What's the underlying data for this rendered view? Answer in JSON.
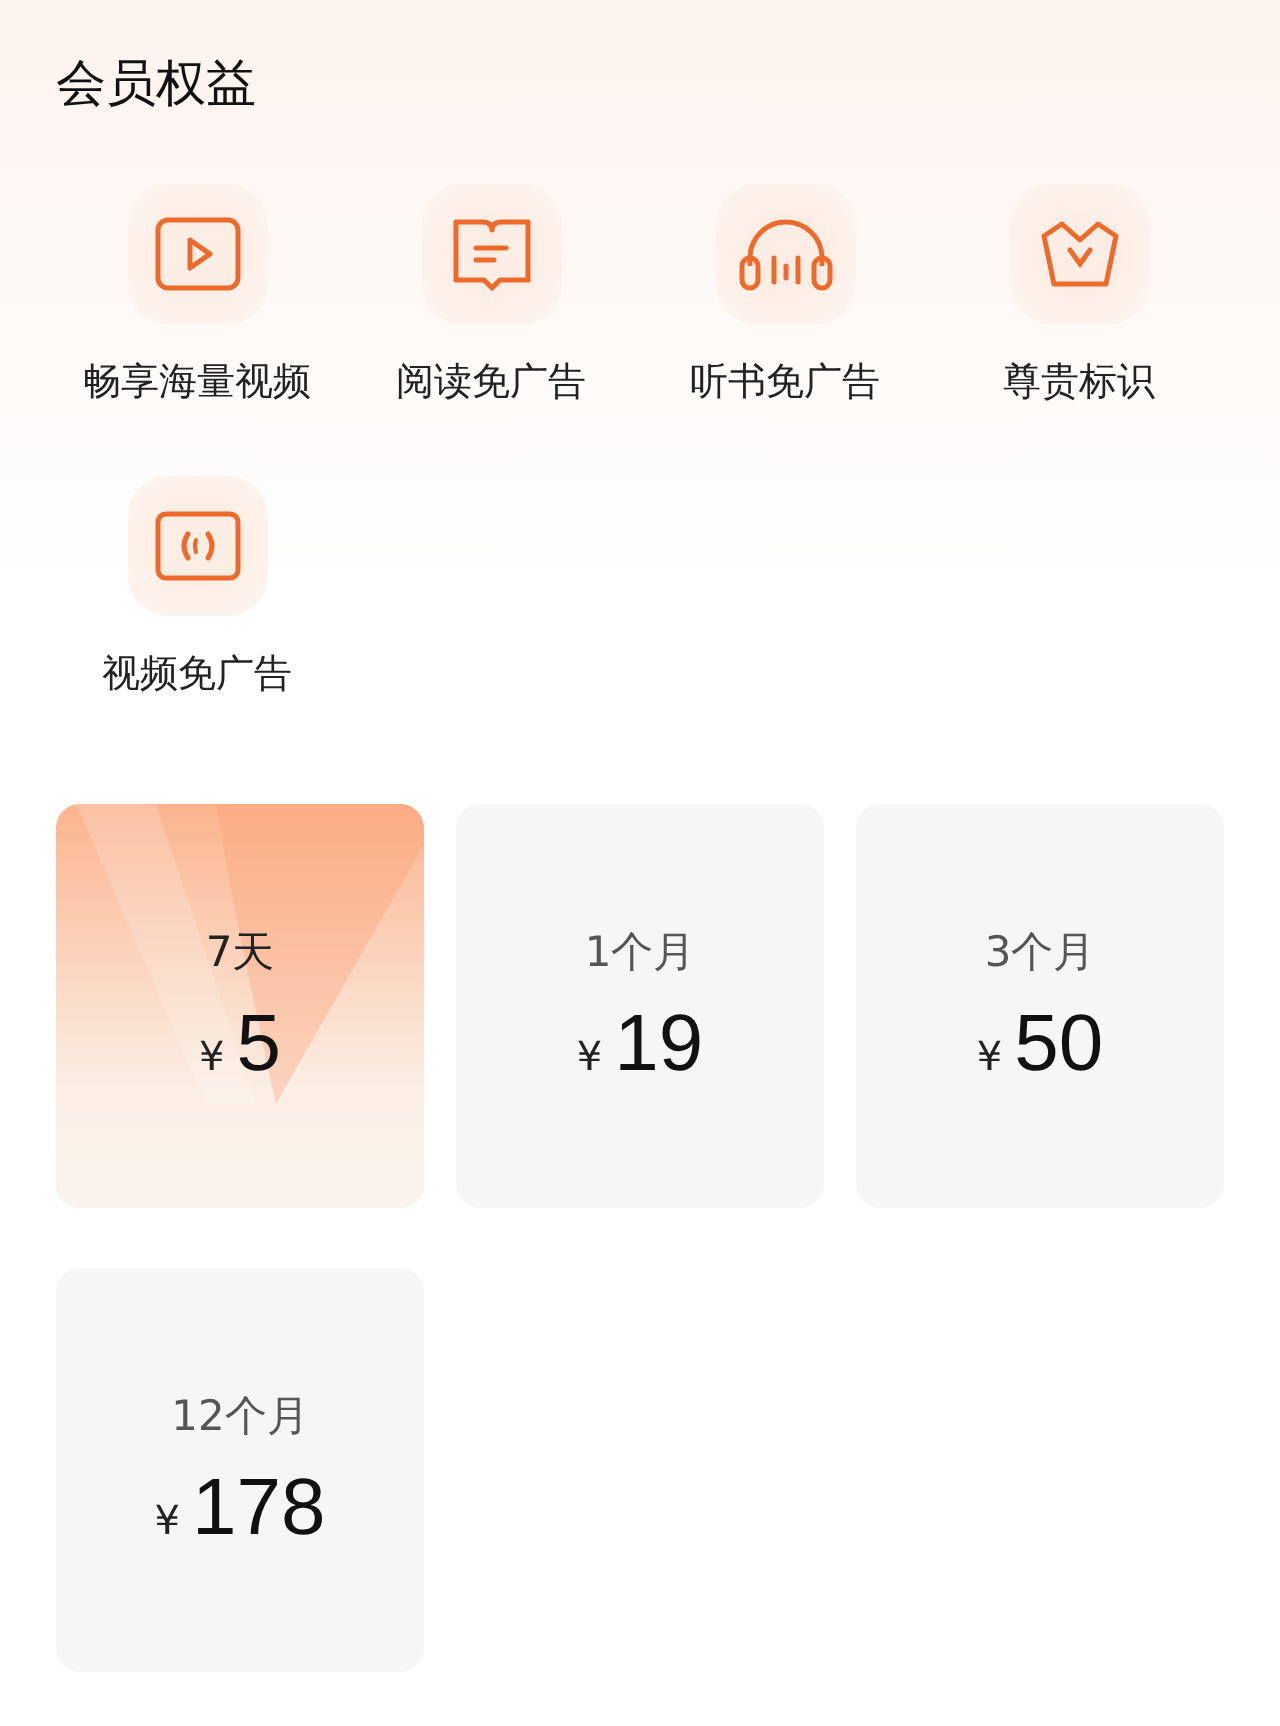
{
  "title": "会员权益",
  "benefits": [
    {
      "kind": "video",
      "label": "畅享海量视频"
    },
    {
      "kind": "book",
      "label": "阅读免广告"
    },
    {
      "kind": "headphones",
      "label": "听书免广告"
    },
    {
      "kind": "crown",
      "label": "尊贵标识"
    },
    {
      "kind": "signal",
      "label": "视频免广告"
    }
  ],
  "plans": [
    {
      "duration": "7天",
      "currency": "¥",
      "price": "5",
      "selected": true
    },
    {
      "duration": "1个月",
      "currency": "¥",
      "price": "19",
      "selected": false
    },
    {
      "duration": "3个月",
      "currency": "¥",
      "price": "50",
      "selected": false
    },
    {
      "duration": "12个月",
      "currency": "¥",
      "price": "178",
      "selected": false
    }
  ]
}
